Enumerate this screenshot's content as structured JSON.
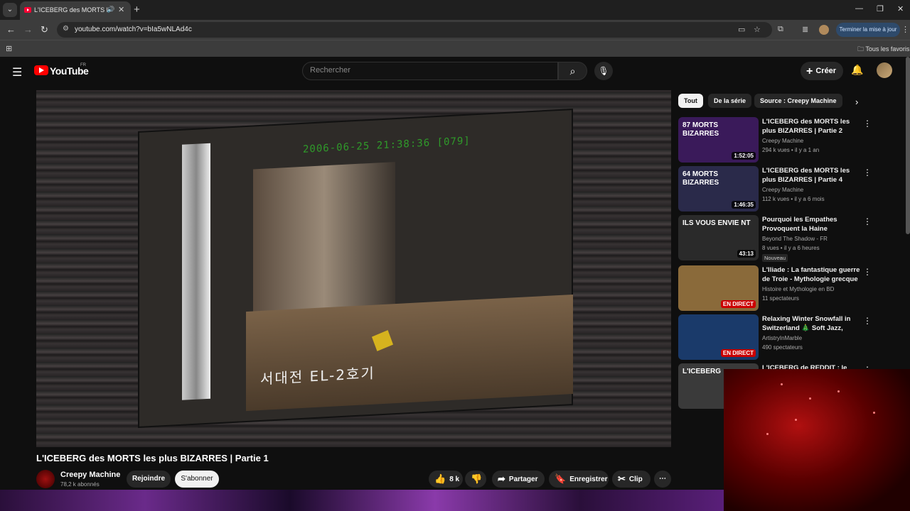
{
  "browser": {
    "tab_title": "L'ICEBERG des MORTS les pl",
    "url": "youtube.com/watch?v=bIa5wNLAd4c",
    "update_label": "Terminer la mise à jour",
    "bookmarks_all": "Tous les favoris"
  },
  "yt": {
    "logo_text": "YouTube",
    "country": "FR",
    "search_placeholder": "Rechercher",
    "create_label": "Créer"
  },
  "video": {
    "osd_timestamp": "2006-06-25 21:38:36 [079]",
    "osd_label": "서대전 EL-2호기",
    "title": "L'ICEBERG des MORTS les plus BIZARRES | Partie 1",
    "channel": "Creepy Machine",
    "subscribers": "78,2 k abonnés",
    "join_label": "Rejoindre",
    "subscribe_label": "S'abonner",
    "likes": "8 k",
    "share_label": "Partager",
    "save_label": "Enregistrer",
    "clip_label": "Clip"
  },
  "chips": [
    "Tout",
    "De la série",
    "Source : Creepy Machine"
  ],
  "recommendations": [
    {
      "title": "L'ICEBERG des MORTS les plus BIZARRES | Partie 2",
      "channel": "Creepy Machine",
      "meta": "294 k vues • il y a 1 an",
      "duration": "1:52:05",
      "thumb_text": "87 MORTS BIZARRES",
      "color": "#3a1a5a"
    },
    {
      "title": "L'ICEBERG des MORTS les plus BIZARRES | Partie 4",
      "channel": "Creepy Machine",
      "meta": "112 k vues • il y a 6 mois",
      "duration": "1:46:35",
      "thumb_text": "64 MORTS BIZARRES",
      "color": "#2a2a4a"
    },
    {
      "title": "Pourquoi les Empathes Provoquent la Haine Silencieu...",
      "channel": "Beyond The Shadow - FR",
      "meta": "8 vues • il y a 6 heures",
      "duration": "43:13",
      "badge": "Nouveau",
      "thumb_text": "ILS VOUS ENVIE NT",
      "color": "#2a2a2a"
    },
    {
      "title": "L'Iliade : La fantastique guerre de Troie - Mythologie grecque",
      "channel": "Histoire et Mythologie en BD",
      "meta": "11 spectateurs",
      "live": "EN DIRECT",
      "thumb_text": "",
      "color": "#8a6a3a"
    },
    {
      "title": "Relaxing Winter Snowfall in Switzerland 🎄 Soft Jazz, Coz...",
      "channel": "ArtistryInMarble",
      "meta": "490 spectateurs",
      "live": "EN DIRECT",
      "thumb_text": "",
      "color": "#1a3a6a"
    },
    {
      "title": "L'ICEBERG de REDDIT : le site le",
      "channel": "",
      "meta": "",
      "thumb_text": "L'ICEBERG",
      "color": "#3a3a3a"
    }
  ]
}
